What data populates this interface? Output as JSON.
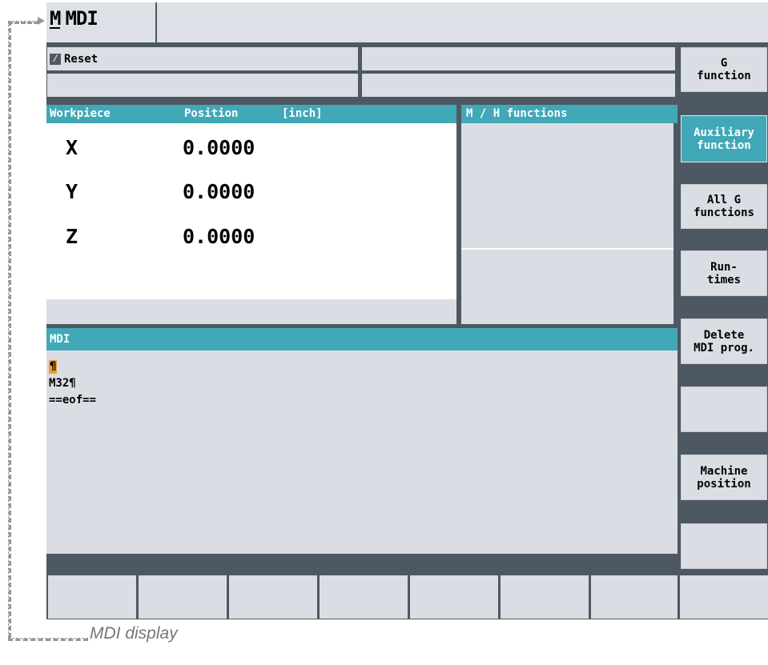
{
  "title": {
    "icon_letter": "M",
    "label": "MDI"
  },
  "status": {
    "reset_label": "Reset",
    "reset_icon": "reset-slash-icon"
  },
  "position_window": {
    "col_workpiece": "Workpiece",
    "col_position": "Position",
    "col_unit": "[inch]",
    "axes": [
      {
        "name": "X",
        "value": "0.0000"
      },
      {
        "name": "Y",
        "value": "0.0000"
      },
      {
        "name": "Z",
        "value": "0.0000"
      }
    ]
  },
  "mh_window": {
    "title": "M / H functions"
  },
  "mdi_window": {
    "title": "MDI",
    "lines": [
      "¶",
      "M32¶",
      "==eof=="
    ]
  },
  "vertical_softkeys": [
    "G\nfunction",
    "Auxiliary\nfunction",
    "All G\nfunctions",
    "Run-\ntimes",
    "Delete\nMDI prog.",
    "",
    "Machine\nposition",
    ""
  ],
  "caption": "MDI display",
  "colors": {
    "accent": "#41a8b8",
    "frame": "#4e5862",
    "panel": "#dadde3",
    "cursor": "#f0a030"
  }
}
